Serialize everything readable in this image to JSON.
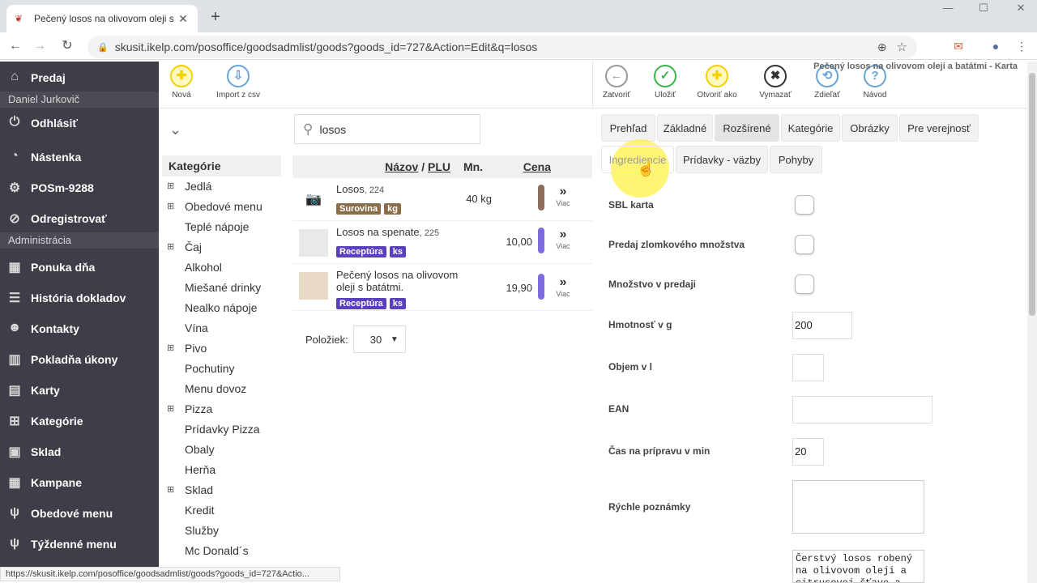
{
  "browser": {
    "tab_title": "Pečený losos na olivovom oleji s b",
    "url": "skusit.ikelp.com/posoffice/goodsadmlist/goods?goods_id=727&Action=Edit&q=losos",
    "status_url": "https://skusit.ikelp.com/posoffice/goodsadmlist/goods?goods_id=727&Actio..."
  },
  "sidebar": {
    "predaj": "Predaj",
    "user": "Daniel Jurkovič",
    "odhlasit": "Odhlásiť",
    "nastenka": "Nástenka",
    "posm": "POSm-9288",
    "odregistrovat": "Odregistrovať",
    "admin": "Administrácia",
    "ponuka": "Ponuka dňa",
    "historia": "História dokladov",
    "kontakty": "Kontakty",
    "pokladna": "Pokladňa úkony",
    "karty": "Karty",
    "kategorie": "Kategórie",
    "sklad": "Sklad",
    "kampane": "Kampane",
    "obedove": "Obedové menu",
    "tyzdenne": "Týždenné menu"
  },
  "actions": {
    "nova": "Nová",
    "import": "Import z csv",
    "zatvorit": "Zatvoriť",
    "ulozit": "Uložiť",
    "otvorit": "Otvoriť ako",
    "vymazat": "Vymazať",
    "zdielat": "Zdieľať",
    "navod": "Návod"
  },
  "karta_title": "Pečený losos na olivovom oleji a batátmi - Karta",
  "search": {
    "value": "losos"
  },
  "categories": {
    "head": "Kategórie",
    "items": [
      "Jedlá",
      "Obedové menu",
      "Teplé nápoje",
      "Čaj",
      "Alkohol",
      "Miešané drinky",
      "Nealko nápoje",
      "Vína",
      "Pivo",
      "Pochutiny",
      "Menu dovoz",
      "Pizza",
      "Prídavky Pizza",
      "Obaly",
      "Herňa",
      "Sklad",
      "Kredit",
      "Služby",
      "Mc Donald´s"
    ]
  },
  "plist": {
    "col_name": "Názov",
    "col_plu": "PLU",
    "col_mn": "Mn.",
    "col_cena": "Cena",
    "more": "Viac",
    "rows": [
      {
        "name": "Losos",
        "code": ", 224",
        "badge1": "Surovina",
        "badge2": "kg",
        "qty": "40 kg",
        "price": ""
      },
      {
        "name": "Losos na spenate",
        "code": ", 225",
        "badge1": "Receptúra",
        "badge2": "ks",
        "qty": "",
        "price": "10,00"
      },
      {
        "name": "Pečený losos na olivovom oleji s batátmi.",
        "code": "",
        "badge1": "Receptúra",
        "badge2": "ks",
        "qty": "",
        "price": "19,90"
      }
    ],
    "pager_label": "Položiek",
    "pager_value": "30"
  },
  "tabs": {
    "prehlad": "Prehľad",
    "zakladne": "Základné",
    "rozsirene": "Rozšírené",
    "kategorie": "Kategórie",
    "obrazky": "Obrázky",
    "verejnost": "Pre verejnosť",
    "ingrediencie": "Ingrediencie",
    "pridavky": "Prídavky - väzby",
    "pohyby": "Pohyby"
  },
  "form": {
    "sbl": "SBL karta",
    "zlomkove": "Predaj zlomkového množstva",
    "mnozstvo": "Množstvo v predaji",
    "hmotnost": "Hmotnosť v g",
    "hmotnost_val": "200",
    "objem": "Objem v l",
    "objem_val": "",
    "ean": "EAN",
    "ean_val": "",
    "cas": "Čas na prípravu v min",
    "cas_val": "20",
    "poznamky": "Rýchle poznámky",
    "popis_text": "Čerstvý losos robený na olivovom oleji a citrusovej šťave a"
  }
}
